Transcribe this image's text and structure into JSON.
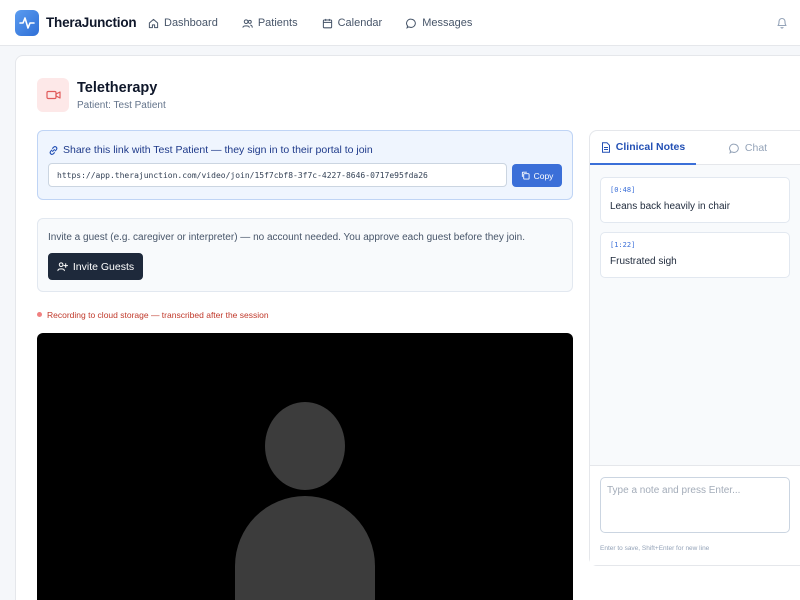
{
  "app": {
    "name": "TheraJunction"
  },
  "nav": {
    "items": [
      {
        "label": "Dashboard",
        "icon": "home-icon"
      },
      {
        "label": "Patients",
        "icon": "users-icon"
      },
      {
        "label": "Calendar",
        "icon": "calendar-icon"
      },
      {
        "label": "Messages",
        "icon": "message-icon"
      }
    ],
    "notifications_icon": "bell-icon"
  },
  "page": {
    "title": "Teletherapy",
    "subtitle": "Patient: Test Patient",
    "icon": "video-camera-icon",
    "icon_color": "#e05a5a"
  },
  "share": {
    "text": "Share this link with Test Patient — they sign in to their portal to join",
    "link": "https://app.therajunction.com/video/join/15f7cbf8-3f7c-4227-8646-0717e95fda26",
    "copy_label": "Copy"
  },
  "guest": {
    "text": "Invite a guest (e.g. caregiver or interpreter) — no account needed. You approve each guest before they join.",
    "button_label": "Invite Guests"
  },
  "recording": {
    "status": "Recording to cloud storage — transcribed after the session"
  },
  "notes_panel": {
    "tabs": [
      {
        "label": "Clinical Notes",
        "active": true,
        "icon": "document-icon"
      },
      {
        "label": "Chat",
        "active": false,
        "icon": "chat-icon"
      }
    ],
    "notes": [
      {
        "time": "[0:48]",
        "text": "Leans back heavily in chair"
      },
      {
        "time": "[1:22]",
        "text": "Frustrated sigh"
      }
    ],
    "input_placeholder": "Type a note and press Enter...",
    "hint": "Enter to save, Shift+Enter for new line"
  },
  "colors": {
    "accent": "#3b6fd8",
    "dark_button": "#1e293b",
    "recording": "#c0392b"
  }
}
